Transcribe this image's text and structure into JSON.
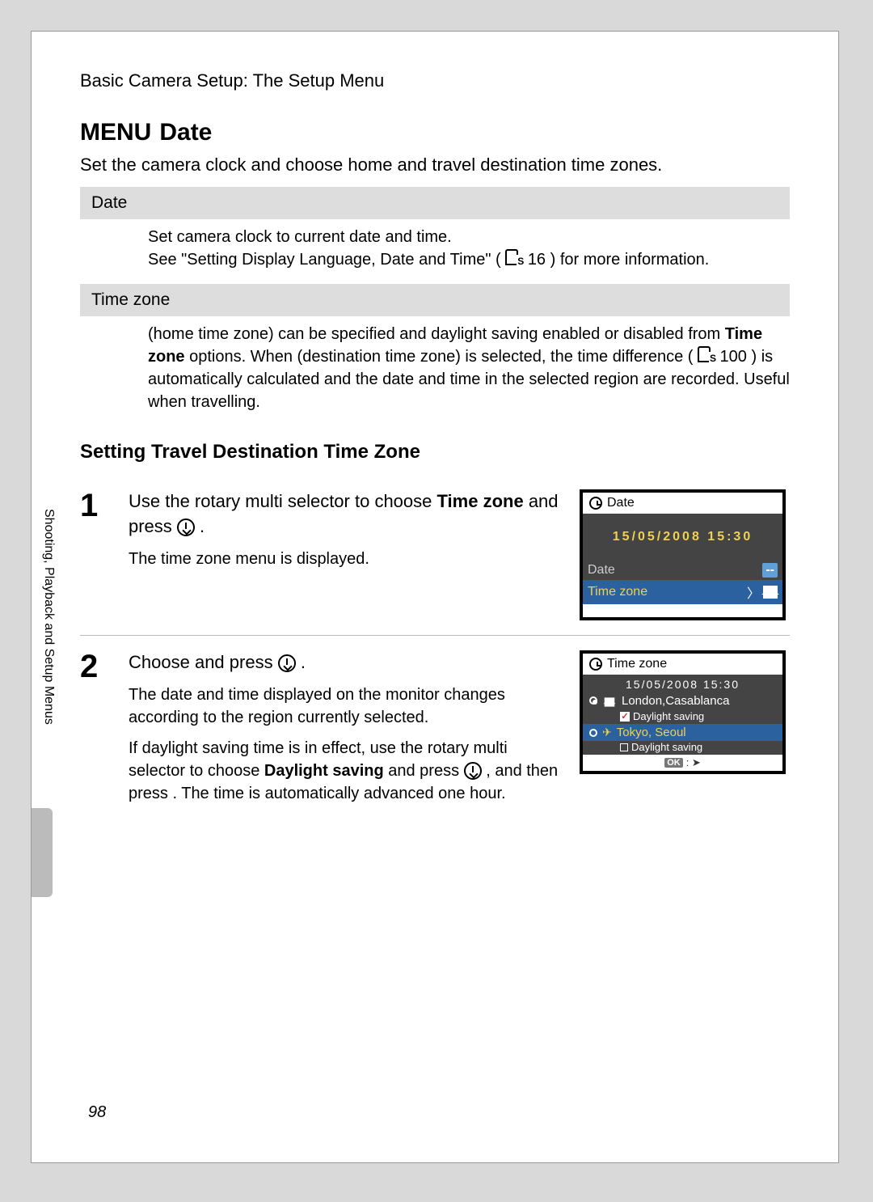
{
  "breadcrumb": "Basic Camera Setup: The Setup Menu",
  "menu_label": "MENU",
  "title": "Date",
  "intro": "Set the camera clock and choose home and travel destination time zones.",
  "sections": {
    "date": {
      "bar": "Date",
      "line1": "Set camera clock to current date and time.",
      "line2_a": "See \"Setting Display Language, Date and Time\" (",
      "line2_ref": " 16",
      "line2_b": ") for more information."
    },
    "tz": {
      "bar": "Time zone",
      "line1_a": " (home time zone) can be specified and daylight saving enabled or disabled from ",
      "bold1": "Time zone",
      "line1_b": " options. When ",
      "line1_c": " (destination time zone) is selected, the time difference (",
      "line1_ref": " 100",
      "line1_d": ") is automatically calculated and the date and time in the selected region are recorded. Useful when travelling."
    }
  },
  "heading": "Setting Travel Destination Time Zone",
  "steps": {
    "s1": {
      "num": "1",
      "t1_a": "Use the rotary multi selector to choose ",
      "t1_bold": "Time zone",
      "t1_b": " and press ",
      "t1_c": ".",
      "sub": "The time zone menu is displayed."
    },
    "s2": {
      "num": "2",
      "t1_a": "Choose ",
      "t1_b": " and press ",
      "t1_c": ".",
      "sub1": "The date and time displayed on the monitor changes according to the region currently selected.",
      "sub2_a": "If daylight saving time is in effect, use the rotary multi selector to choose ",
      "sub2_bold": "Daylight saving",
      "sub2_b": " and press ",
      "sub2_c": ", and then press ",
      "sub2_d": ". The time is automatically advanced one hour."
    }
  },
  "lcd1": {
    "title": "Date",
    "datetime": "15/05/2008   15:30",
    "row_date": "Date",
    "row_tz": "Time zone"
  },
  "lcd2": {
    "title": "Time zone",
    "datetime": "15/05/2008   15:30",
    "home": "London,Casablanca",
    "home_dst": "Daylight saving",
    "dest": "Tokyo, Seoul",
    "dest_dst": "Daylight saving",
    "ok": "OK"
  },
  "sidebar": "Shooting, Playback and Setup Menus",
  "page_number": "98"
}
